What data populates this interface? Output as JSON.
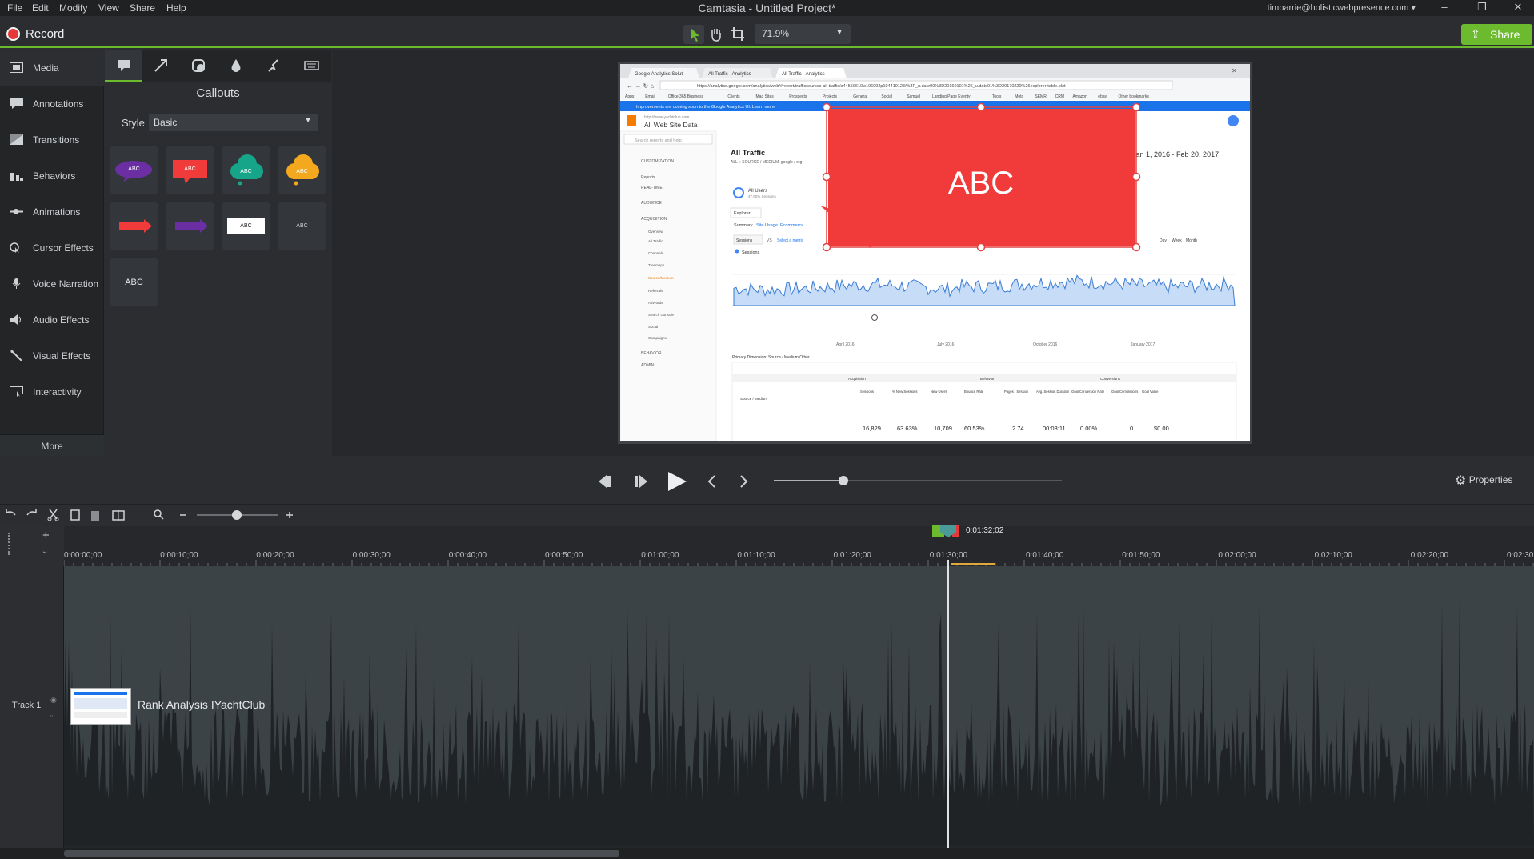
{
  "menu": [
    "File",
    "Edit",
    "Modify",
    "View",
    "Share",
    "Help"
  ],
  "window_title": "Camtasia - Untitled Project*",
  "user": "timbarrie@holisticwebpresence.com",
  "record_label": "Record",
  "zoom": "71.9%",
  "share_label": "Share",
  "nav": [
    {
      "label": "Media",
      "icon": "film-icon"
    },
    {
      "label": "Annotations",
      "icon": "annotation-icon"
    },
    {
      "label": "Transitions",
      "icon": "transition-icon"
    },
    {
      "label": "Behaviors",
      "icon": "behavior-icon"
    },
    {
      "label": "Animations",
      "icon": "animation-icon"
    },
    {
      "label": "Cursor Effects",
      "icon": "cursor-icon"
    },
    {
      "label": "Voice Narration",
      "icon": "microphone-icon"
    },
    {
      "label": "Audio Effects",
      "icon": "speaker-icon"
    },
    {
      "label": "Visual Effects",
      "icon": "wand-icon"
    },
    {
      "label": "Interactivity",
      "icon": "interactivity-icon"
    }
  ],
  "more_label": "More",
  "panel": {
    "title": "Callouts",
    "style_label": "Style",
    "style_value": "Basic",
    "thumb_text": "ABC"
  },
  "preview": {
    "tabs": [
      "Google Analytics Soluti",
      "All Traffic - Analytics",
      "All Traffic - Analytics"
    ],
    "url": "https://analytics.google.com/analytics/web/#report/trafficsources-all-traffic/a44559610w106992p104410128/%3F_u.date00%3D20160101%26_u.date01%3D20170220%26explorer-table.plot",
    "bookmarks": [
      "Apps",
      "Email",
      "Office 365 Business",
      "Clients",
      "Mag Sites",
      "Prospects",
      "Projects",
      "General",
      "Social",
      "Samuel",
      "Landing Page Eventy",
      "Tools",
      "Moto",
      "SEMR",
      "CRM",
      "Amazon",
      "ebay",
      "Other bookmarks"
    ],
    "banner": "Improvements are coming soon to the Google Analytics UI. Learn more.",
    "account_small": "http://www.yachtclub.com",
    "account": "All Web Site Data",
    "search_placeholder": "Search reports and help",
    "side": [
      "CUSTOMIZATION",
      "Reports",
      "REAL-TIME",
      "AUDIENCE",
      "ACQUISITION",
      "Overview",
      "All Traffic",
      "Channels",
      "Treemaps",
      "Source/Medium",
      "Referrals",
      "AdWords",
      "Search Console",
      "Social",
      "Campaigns",
      "BEHAVIOR",
      "ADMIN"
    ],
    "report_title": "All Traffic",
    "report_sub": "ALL » SOURCE / MEDIUM: google / org",
    "date_range": "Jan 1, 2016 - Feb 20, 2017",
    "all_users": "All Users",
    "all_users_sub": "47.90% Sessions",
    "explorer": "Explorer",
    "subtabs": [
      "Summary",
      "Site Usage",
      "Ecommerce"
    ],
    "sessions_metric": "Sessions",
    "vs_label": "VS",
    "select_metric": "Select a metric",
    "granularity": [
      "Day",
      "Week",
      "Month"
    ],
    "axis_dates": [
      "April 2016",
      "July 2016",
      "October 2016",
      "January 2017"
    ],
    "primary_dim": "Primary Dimension:  Source / Medium   Other",
    "table_headers": [
      "Source / Medium",
      "Acquisition",
      "Behavior",
      "Conversions",
      "Sessions",
      "% New Sessions",
      "New Users",
      "Bounce Rate",
      "Pages / Session",
      "Avg. Session Duration",
      "Goal Conversion Rate",
      "Goal Completions",
      "Goal Value"
    ],
    "totals": [
      "16,829",
      "63.63%",
      "10,709",
      "60.53%",
      "2.74",
      "00:03:11",
      "0.00%",
      "0",
      "$0.00"
    ],
    "callout_text": "ABC"
  },
  "properties_label": "Properties",
  "timecode": "0:01:32;02",
  "ruler": [
    "0:00:00;00",
    "0:00:10;00",
    "0:00:20;00",
    "0:00:30;00",
    "0:00:40;00",
    "0:00:50;00",
    "0:01:00;00",
    "0:01:10;00",
    "0:01:20;00",
    "0:01:30;00",
    "0:01:40;00",
    "0:01:50;00",
    "0:02:00;00",
    "0:02:10;00",
    "0:02:20;00",
    "0:02:30;"
  ],
  "track_label": "Track 1",
  "clip_label": "Rank Analysis IYachtClub",
  "colors": {
    "accent": "#6cba2e",
    "record": "#e53838",
    "callout": "#f13b3b",
    "clip": "#3c4347"
  }
}
